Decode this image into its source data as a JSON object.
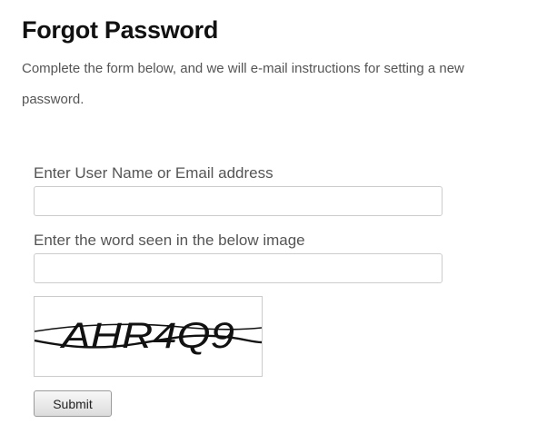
{
  "header": {
    "title": "Forgot Password",
    "instructions": "Complete the form below, and we will e-mail instructions for setting a new password."
  },
  "form": {
    "username_label": "Enter User Name or Email address",
    "username_value": "",
    "captcha_label": "Enter the word seen in the below image",
    "captcha_value": "",
    "captcha_image_text": "AHR4Q9",
    "submit_label": "Submit"
  }
}
